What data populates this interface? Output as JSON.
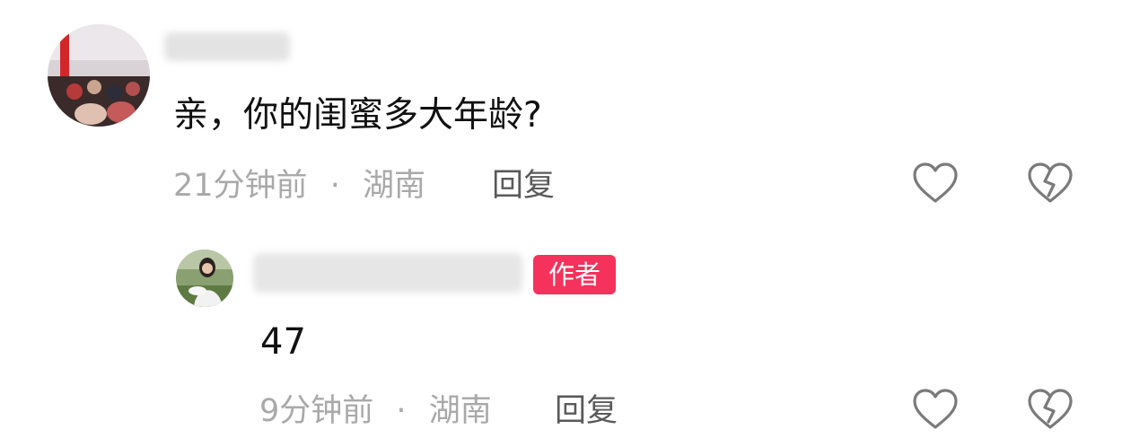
{
  "comments": [
    {
      "text": "亲，你的闺蜜多大年龄?",
      "time": "21分钟前",
      "separator": "·",
      "location": "湖南",
      "reply_label": "回复",
      "like_icon": "heart-outline-icon",
      "dislike_icon": "broken-heart-outline-icon"
    }
  ],
  "reply": {
    "badge": "作者",
    "text": "47",
    "time": "9分钟前",
    "separator": "·",
    "location": "湖南",
    "reply_label": "回复",
    "like_icon": "heart-outline-icon",
    "dislike_icon": "broken-heart-outline-icon"
  },
  "colors": {
    "badge_bg": "#f5325c",
    "meta_text": "#a9a9a9",
    "reply_text": "#5a5a5a",
    "icon_stroke": "#7a7a7a",
    "body_text": "#111111"
  }
}
